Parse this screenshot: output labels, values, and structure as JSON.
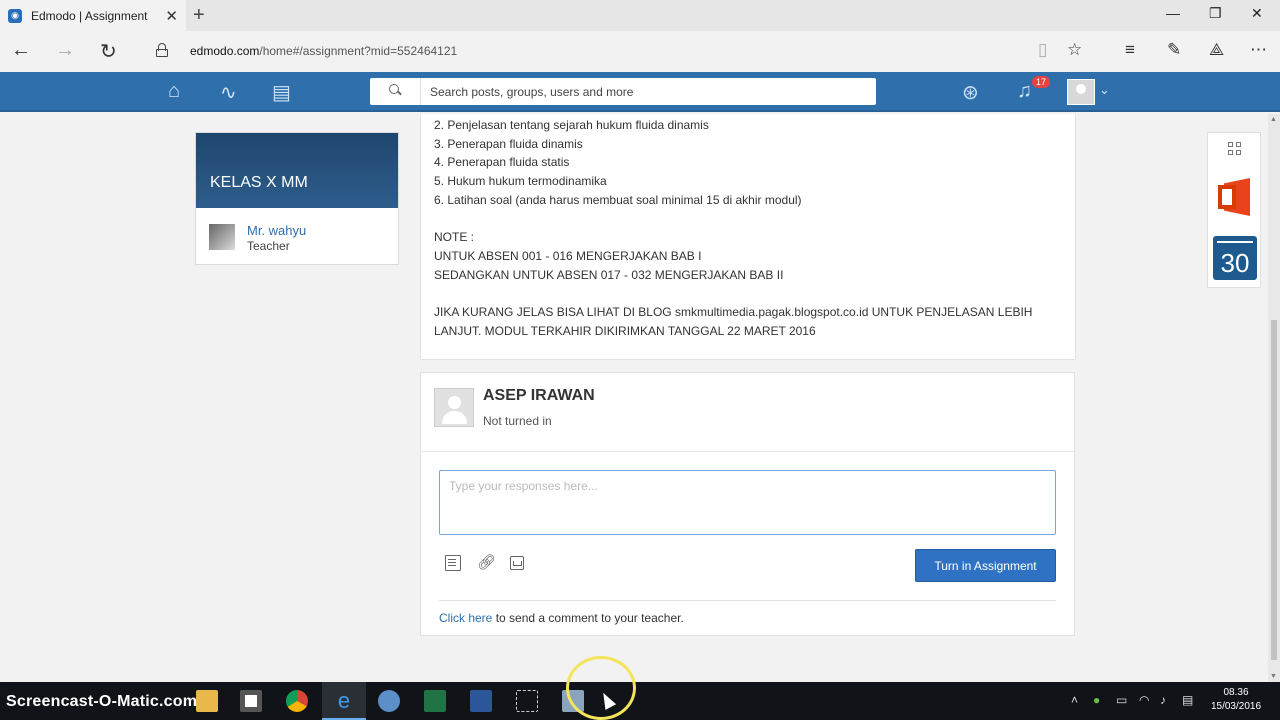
{
  "browser": {
    "tab_title": "Edmodo | Assignment",
    "url_host": "edmodo.com",
    "url_path": "/home#/assignment?mid=552464121"
  },
  "header": {
    "search_placeholder": "Search posts, groups, users and more",
    "notification_count": "17"
  },
  "sidebar": {
    "group_name": "KELAS X MM",
    "teacher_name": "Mr. wahyu",
    "teacher_role": "Teacher"
  },
  "assignment": {
    "lines": [
      "2. Penjelasan tentang sejarah hukum fluida dinamis",
      "3. Penerapan fluida dinamis",
      "4. Penerapan fluida statis",
      "5. Hukum hukum termodinamika",
      "6. Latihan soal (anda harus membuat soal minimal 15 di akhir modul)",
      "",
      "NOTE :",
      "UNTUK ABSEN 001 - 016 MENGERJAKAN BAB I",
      "SEDANGKAN UNTUK ABSEN 017 - 032 MENGERJAKAN BAB II",
      "",
      "JIKA KURANG JELAS BISA LIHAT DI BLOG smkmultimedia.pagak.blogspot.co.id UNTUK PENJELASAN LEBIH",
      "LANJUT. MODUL TERKAHIR DIKIRIMKAN TANGGAL 22 MARET 2016"
    ]
  },
  "submission": {
    "student_name": "ASEP IRAWAN",
    "status": "Not turned in",
    "response_placeholder": "Type your responses here...",
    "turn_in_label": "Turn in Assignment",
    "comment_link": "Click here",
    "comment_rest": " to send a comment to your teacher."
  },
  "apps": {
    "calendar_day": "30"
  },
  "taskbar": {
    "brand": "Screencast-O-Matic.com",
    "time": "08.36",
    "date": "15/03/2016"
  },
  "colors": {
    "header_blue": "#2f6fac",
    "button_blue": "#2f72c3",
    "badge_red": "#e54141"
  }
}
